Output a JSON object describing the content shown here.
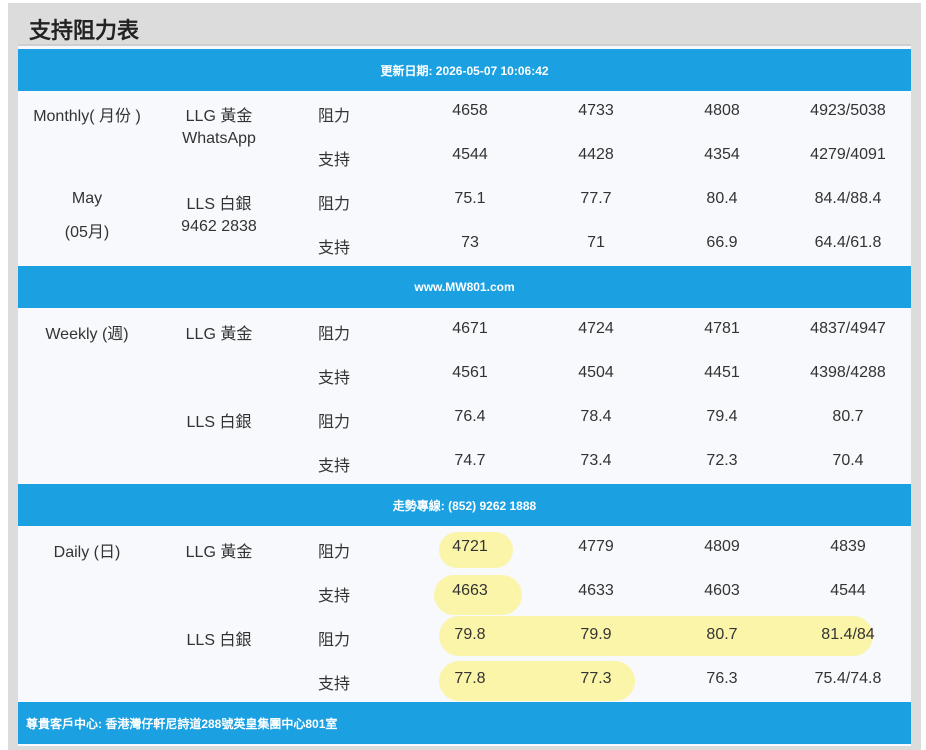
{
  "title": "支持阻力表",
  "update_bar": "更新日期: 2026-05-07 10:06:42",
  "website_bar": "www.MW801.com",
  "hotline_bar": "走勢專線: (852) 9262 1888",
  "address_bar": "尊貴客戶中心: 香港灣仔軒尼詩道288號英皇集團中心801室",
  "monthly": {
    "period_line1": "Monthly( 月份 )",
    "period_line2": "May",
    "period_line3": "(05月)",
    "llg_label": "LLG 黃金",
    "whatsapp_label": "WhatsApp",
    "lls_label": "LLS 白銀",
    "phone": "9462 2838",
    "rows": [
      {
        "type": "阻力",
        "v1": "4658",
        "v2": "4733",
        "v3": "4808",
        "v4": "4923/5038"
      },
      {
        "type": "支持",
        "v1": "4544",
        "v2": "4428",
        "v3": "4354",
        "v4": "4279/4091"
      },
      {
        "type": "阻力",
        "v1": "75.1",
        "v2": "77.7",
        "v3": "80.4",
        "v4": "84.4/88.4"
      },
      {
        "type": "支持",
        "v1": "73",
        "v2": "71",
        "v3": "66.9",
        "v4": "64.4/61.8"
      }
    ]
  },
  "weekly": {
    "period": "Weekly (週)",
    "llg_label": "LLG 黃金",
    "lls_label": "LLS 白銀",
    "rows": [
      {
        "type": "阻力",
        "v1": "4671",
        "v2": "4724",
        "v3": "4781",
        "v4": "4837/4947"
      },
      {
        "type": "支持",
        "v1": "4561",
        "v2": "4504",
        "v3": "4451",
        "v4": "4398/4288"
      },
      {
        "type": "阻力",
        "v1": "76.4",
        "v2": "78.4",
        "v3": "79.4",
        "v4": "80.7"
      },
      {
        "type": "支持",
        "v1": "74.7",
        "v2": "73.4",
        "v3": "72.3",
        "v4": "70.4"
      }
    ]
  },
  "daily": {
    "period": "Daily (日)",
    "llg_label": "LLG 黃金",
    "lls_label": "LLS 白銀",
    "rows": [
      {
        "type": "阻力",
        "v1": "4721",
        "v2": "4779",
        "v3": "4809",
        "v4": "4839"
      },
      {
        "type": "支持",
        "v1": "4663",
        "v2": "4633",
        "v3": "4603",
        "v4": "4544"
      },
      {
        "type": "阻力",
        "v1": "79.8",
        "v2": "79.9",
        "v3": "80.7",
        "v4": "81.4/84"
      },
      {
        "type": "支持",
        "v1": "77.8",
        "v2": "77.3",
        "v3": "76.3",
        "v4": "75.4/74.8"
      }
    ]
  },
  "colors": {
    "bar": "#1ba1e2",
    "highlight": "#fbf59a",
    "panel": "#dcdcdc"
  }
}
